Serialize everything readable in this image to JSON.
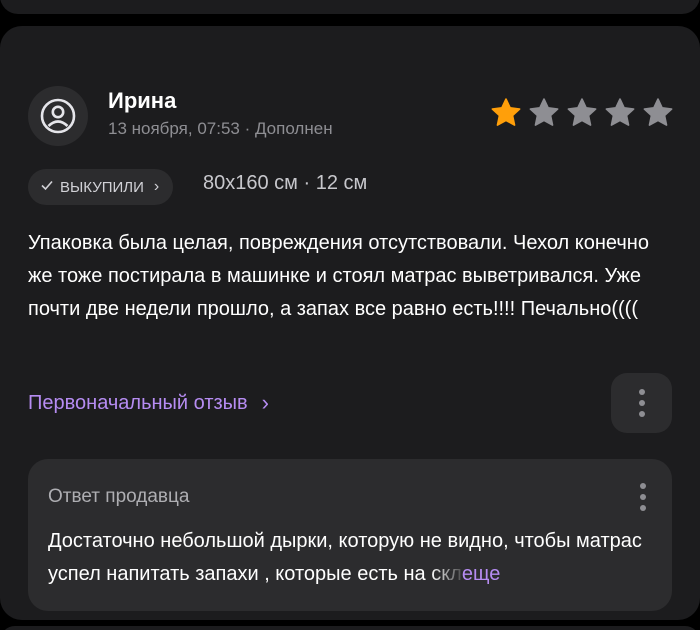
{
  "review": {
    "author": "Ирина",
    "meta": "13 ноября, 07:53 · Дополнен",
    "rating": 1,
    "max_rating": 5,
    "star_color_active": "#ff9f0a",
    "star_color_inactive": "#8e8e93",
    "badge_label": "ВЫКУПИЛИ",
    "variant": "80x160 см · 12 см",
    "text": "Упаковка была целая, повреждения отсутствовали. Чехол конечно же тоже постирала в машинке и стоял матрас выветривался. Уже почти две недели прошло, а запах все равно есть!!!! Печально((((",
    "original_link": "Первоначальный отзыв"
  },
  "seller_reply": {
    "title": "Ответ продавца",
    "text_main": "Достаточно небольшой дырки, которую не видно, чтобы матрас успел напитать запахи , которые есть на ",
    "text_fade": "скл",
    "more_label": "еще"
  },
  "colors": {
    "accent": "#b68cf2",
    "card_bg": "#1c1c1e",
    "inner_bg": "#2c2c2e"
  }
}
